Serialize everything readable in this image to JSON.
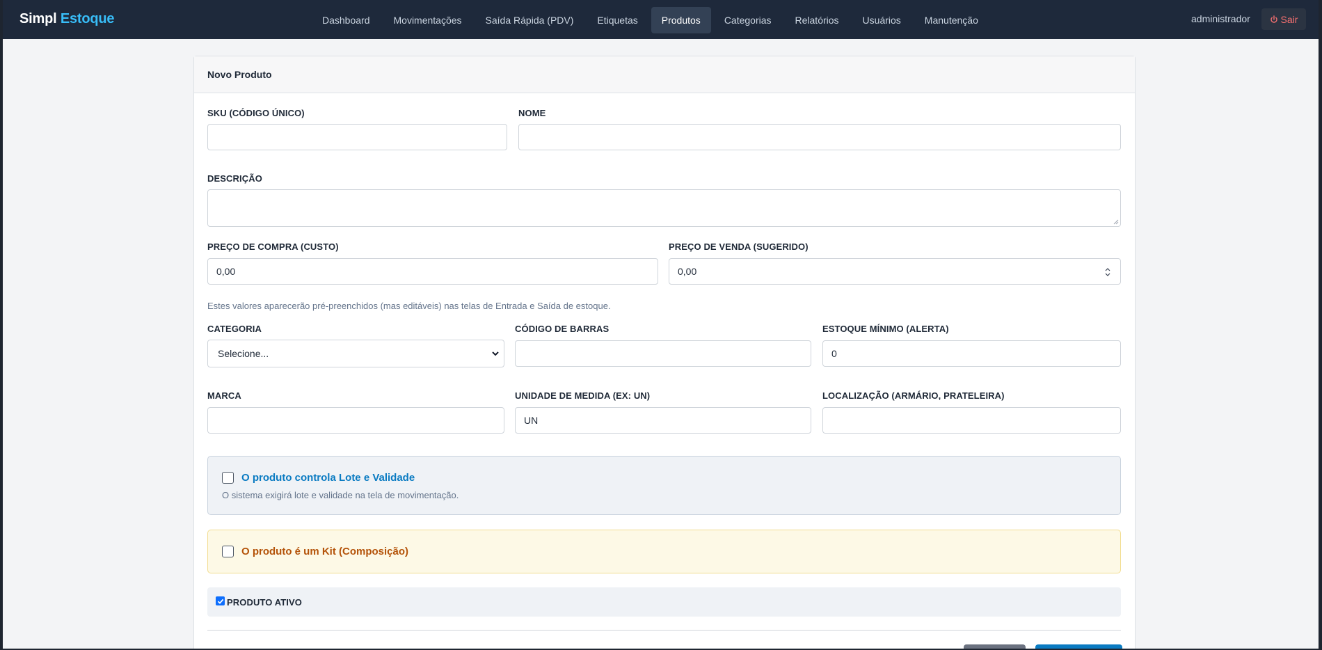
{
  "app": {
    "brand_main": "Simpl",
    "brand_accent": "Estoque"
  },
  "nav": {
    "items": [
      "Dashboard",
      "Movimentações",
      "Saída Rápida (PDV)",
      "Etiquetas",
      "Produtos",
      "Categorias",
      "Relatórios",
      "Usuários",
      "Manutenção"
    ],
    "active": "Produtos"
  },
  "header": {
    "user": "administrador",
    "logout_label": "Sair",
    "logout_icon": "power-icon"
  },
  "form": {
    "title": "Novo Produto",
    "sku": {
      "label": "SKU (CÓDIGO ÚNICO)",
      "value": ""
    },
    "nome": {
      "label": "NOME",
      "value": ""
    },
    "descricao": {
      "label": "DESCRIÇÃO",
      "value": ""
    },
    "preco_compra": {
      "label": "PREÇO DE COMPRA (CUSTO)",
      "value": "0,00"
    },
    "preco_venda": {
      "label": "PREÇO DE VENDA (SUGERIDO)",
      "value": "0,00"
    },
    "preco_hint": "Estes valores aparecerão pré-preenchidos (mas editáveis) nas telas de Entrada e Saída de estoque.",
    "categoria": {
      "label": "CATEGORIA",
      "selected": "Selecione..."
    },
    "codigo_barras": {
      "label": "CÓDIGO DE BARRAS",
      "value": ""
    },
    "estoque_minimo": {
      "label": "ESTOQUE MÍNIMO (ALERTA)",
      "value": "0"
    },
    "marca": {
      "label": "MARCA",
      "value": ""
    },
    "unidade": {
      "label": "UNIDADE DE MEDIDA (EX: UN)",
      "value": "UN"
    },
    "localizacao": {
      "label": "LOCALIZAÇÃO (ARMÁRIO, PRATELEIRA)",
      "value": ""
    },
    "lote": {
      "title": "O produto controla Lote e Validade",
      "description": "O sistema exigirá lote e validade na tela de movimentação.",
      "checked": false
    },
    "kit": {
      "title": "O produto é um Kit (Composição)",
      "checked": false
    },
    "ativo": {
      "label": "PRODUTO ATIVO",
      "checked": true
    }
  },
  "colors": {
    "navbar": "#1e293b",
    "brand_accent": "#38bdf8",
    "logout": "#f87171",
    "lote_title": "#0a7bc2",
    "kit_title": "#b45309",
    "primary": "#0a7bc2"
  }
}
